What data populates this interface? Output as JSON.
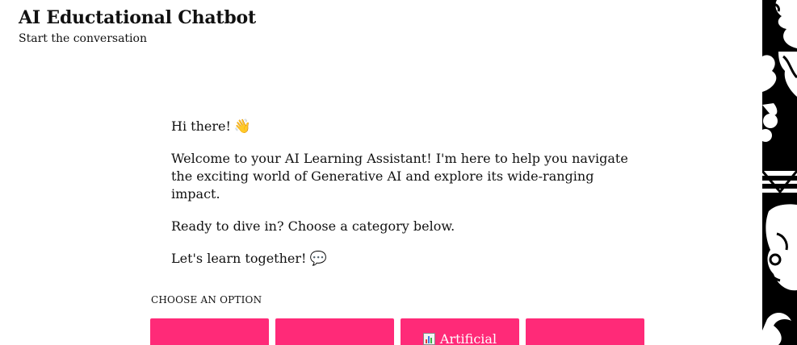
{
  "header": {
    "title": "AI Eductational Chatbot",
    "subtitle": "Start the conversation"
  },
  "message": {
    "greeting": "Hi there!",
    "greeting_emoji": "👋",
    "welcome": "Welcome to your AI Learning Assistant! I'm here to help you navigate the exciting world of Generative AI and explore its wide-ranging impact.",
    "prompt": "Ready to dive in? Choose a category below.",
    "closing": "Let's learn together!",
    "closing_emoji": "💬"
  },
  "options": {
    "label": "CHOOSE AN OPTION",
    "buttons": [
      {
        "label": ""
      },
      {
        "label": ""
      },
      {
        "label": "Artificial",
        "icon": "bar-chart-icon"
      },
      {
        "label": ""
      }
    ]
  },
  "colors": {
    "accent": "#ff2a78",
    "art_background": "#000000"
  }
}
